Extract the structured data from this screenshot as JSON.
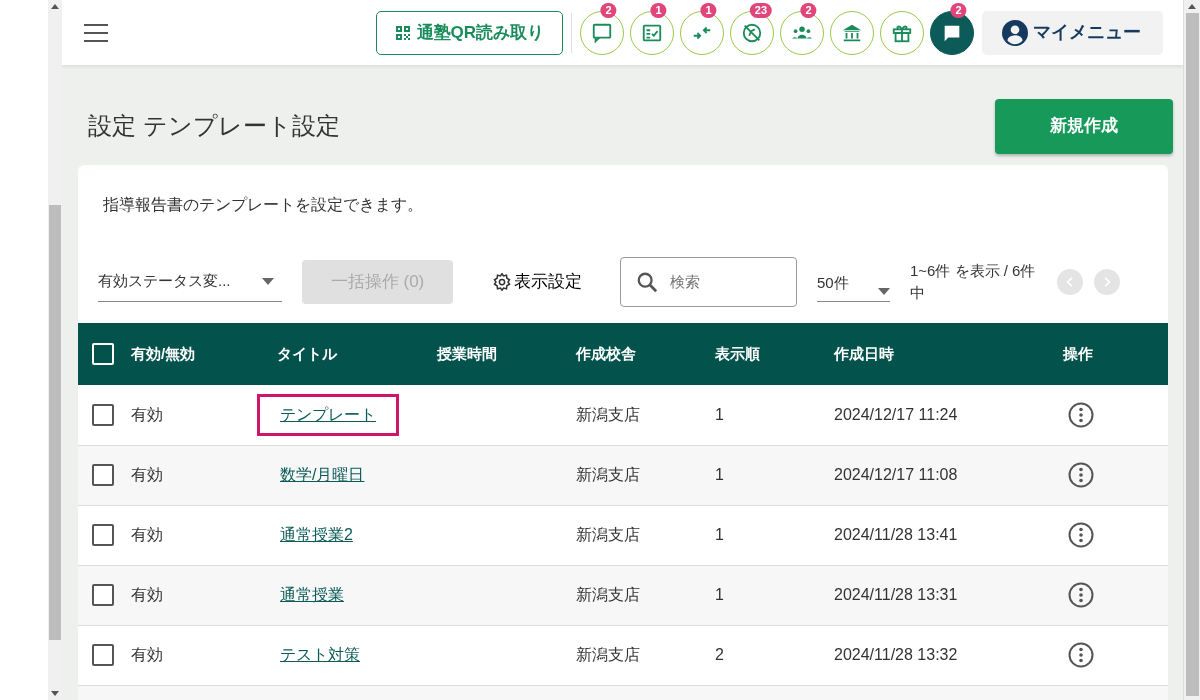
{
  "topbar": {
    "qr_button": "通塾QR読み取り",
    "icon_buttons": [
      {
        "kind": "chat",
        "badge": "2",
        "filled": false
      },
      {
        "kind": "checklist",
        "badge": "1",
        "filled": false
      },
      {
        "kind": "arrows",
        "badge": "1",
        "filled": false
      },
      {
        "kind": "compass-off",
        "badge": "23",
        "filled": false
      },
      {
        "kind": "people",
        "badge": "2",
        "filled": false
      },
      {
        "kind": "school",
        "filled": false
      },
      {
        "kind": "gift",
        "filled": false
      },
      {
        "kind": "message",
        "badge": "2",
        "filled": true
      }
    ],
    "my_menu": "マイメニュー"
  },
  "page": {
    "title": "設定 テンプレート設定",
    "new_button": "新規作成"
  },
  "description": "指導報告書のテンプレートを設定できます。",
  "toolbar": {
    "status_select": "有効ステータス変...",
    "bulk_button": {
      "label": "一括操作 (0)",
      "disabled": true
    },
    "display_settings": "表示設定",
    "search": {
      "placeholder": "検索"
    },
    "per_page": "50件",
    "range": "1~6件 を表示 / 6件中",
    "prev": {
      "disabled": true
    },
    "next": {
      "disabled": true
    }
  },
  "table": {
    "select_all_checked": false,
    "columns": [
      "有効/無効",
      "タイトル",
      "授業時間",
      "作成校舎",
      "表示順",
      "作成日時",
      "操作"
    ],
    "rows": [
      {
        "checked": false,
        "status": "有効",
        "title": "テンプレート",
        "highlighted": true,
        "campus": "新潟支店",
        "order": "1",
        "created": "2024/12/17 11:24"
      },
      {
        "checked": false,
        "status": "有効",
        "title": "数学/月曜日",
        "highlighted": false,
        "campus": "新潟支店",
        "order": "1",
        "created": "2024/12/17 11:08"
      },
      {
        "checked": false,
        "status": "有効",
        "title": "通常授業2",
        "highlighted": false,
        "campus": "新潟支店",
        "order": "1",
        "created": "2024/11/28 13:41"
      },
      {
        "checked": false,
        "status": "有効",
        "title": "通常授業",
        "highlighted": false,
        "campus": "新潟支店",
        "order": "1",
        "created": "2024/11/28 13:31"
      },
      {
        "checked": false,
        "status": "有効",
        "title": "テスト対策",
        "highlighted": false,
        "campus": "新潟支店",
        "order": "2",
        "created": "2024/11/28 13:32"
      }
    ]
  }
}
